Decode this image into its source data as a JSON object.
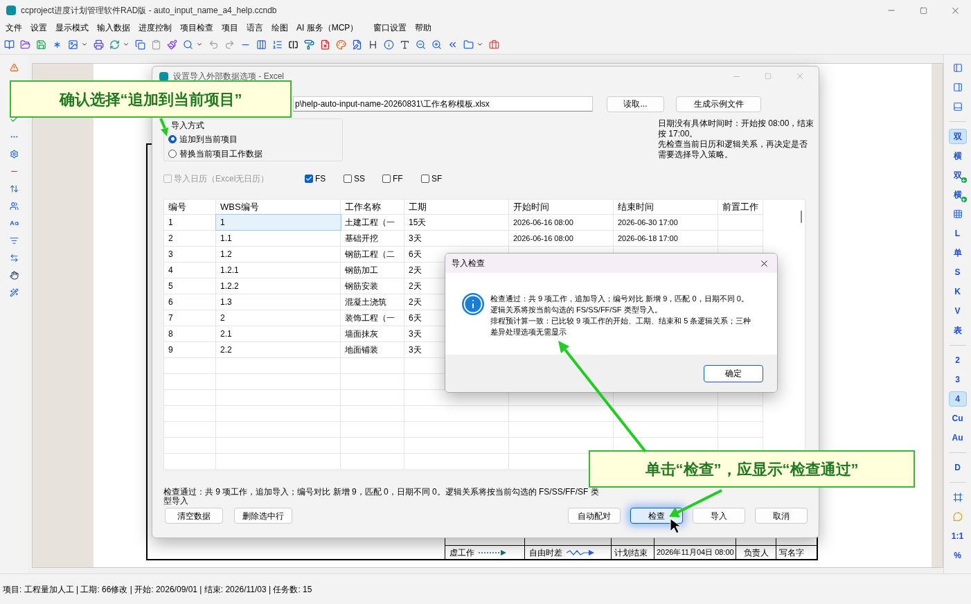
{
  "window": {
    "title": "ccproject进度计划管理软件RAD版 - auto_input_name_a4_help.ccndb"
  },
  "menu": [
    "文件",
    "设置",
    "显示模式",
    "输入数据",
    "进度控制",
    "项目检查",
    "项目",
    "语言",
    "绘图",
    "AI 服务（MCP）",
    "窗口设置",
    "帮助"
  ],
  "right_toolbar": [
    {
      "kind": "panelleft",
      "selected": false
    },
    {
      "kind": "panelright",
      "selected": false
    },
    {
      "kind": "panelbottom",
      "selected": false
    },
    {
      "kind": "separator"
    },
    {
      "kind": "text",
      "label": "双",
      "selected": true
    },
    {
      "kind": "text",
      "label": "横",
      "selected": false
    },
    {
      "kind": "textplus",
      "label": "双",
      "selected": false
    },
    {
      "kind": "textplus",
      "label": "横",
      "selected": false
    },
    {
      "kind": "grid",
      "selected": false
    },
    {
      "kind": "text",
      "label": "L",
      "selected": false
    },
    {
      "kind": "text",
      "label": "单",
      "selected": false
    },
    {
      "kind": "text",
      "label": "S",
      "selected": false
    },
    {
      "kind": "text",
      "label": "K",
      "selected": false
    },
    {
      "kind": "text",
      "label": "V",
      "selected": false
    },
    {
      "kind": "text",
      "label": "表",
      "selected": false
    },
    {
      "kind": "separator"
    },
    {
      "kind": "text",
      "label": "2",
      "selected": false
    },
    {
      "kind": "text",
      "label": "3",
      "selected": false
    },
    {
      "kind": "text",
      "label": "4",
      "selected": true
    },
    {
      "kind": "text",
      "label": "Cu",
      "selected": false
    },
    {
      "kind": "text",
      "label": "Au",
      "selected": false
    },
    {
      "kind": "separator"
    },
    {
      "kind": "text",
      "label": "D",
      "selected": false
    },
    {
      "kind": "separator"
    },
    {
      "kind": "frame",
      "selected": false
    },
    {
      "kind": "bubble",
      "selected": false
    },
    {
      "kind": "text",
      "label": "1:1",
      "selected": false
    },
    {
      "kind": "text",
      "label": "%",
      "selected": false
    }
  ],
  "legend": {
    "rows": [
      {
        "lines": [
          {
            "kind": "dummy",
            "label": "虚工作"
          },
          {
            "kind": "float",
            "label": "自由时差"
          }
        ],
        "field": "计划结束",
        "value": "2026年11月04日 08:00",
        "field2": "负责人",
        "value2": "写名字"
      }
    ]
  },
  "import_dialog": {
    "title": "设置导入外部数据选项 - Excel",
    "file_path": "p\\help-auto-input-name-20260831\\工作名称模板.xlsx",
    "top_buttons": [
      "读取...",
      "生成示例文件"
    ],
    "mode_group": {
      "label": "导入方式",
      "options": [
        {
          "label": "追加到当前项目",
          "selected": true
        },
        {
          "label": "替换当前项目工作数据",
          "selected": false
        }
      ]
    },
    "note": [
      "日期没有具体时间时：开始按 08:00，结束按 17:00。",
      "先检查当前日历和逻辑关系，再决定是否需要选择导入策略。"
    ],
    "options": [
      {
        "label": "导入日历（Excel无日历）",
        "checked": false,
        "disabled": true
      },
      {
        "label": "FS",
        "checked": true,
        "disabled": false
      },
      {
        "label": "SS",
        "checked": false,
        "disabled": false
      },
      {
        "label": "FF",
        "checked": false,
        "disabled": false
      },
      {
        "label": "SF",
        "checked": false,
        "disabled": false
      }
    ],
    "table": {
      "columns": [
        "编号",
        "WBS编号",
        "工作名称",
        "工期",
        "开始时间",
        "结束时间",
        "前置工作"
      ],
      "rows": [
        {
          "cells": [
            "1",
            "1",
            "土建工程（一",
            "15天",
            "2026-06-16 08:00",
            "2026-06-30 17:00"
          ],
          "selected": true
        },
        {
          "cells": [
            "2",
            "1.1",
            "基础开挖",
            "3天",
            "2026-06-16 08:00",
            "2026-06-18 17:00"
          ],
          "selected": false
        },
        {
          "cells": [
            "3",
            "1.2",
            "钢筋工程（二",
            "6天"
          ],
          "selected": false
        },
        {
          "cells": [
            "4",
            "1.2.1",
            "钢筋加工",
            "2天"
          ],
          "selected": false
        },
        {
          "cells": [
            "5",
            "1.2.2",
            "钢筋安装",
            "2天"
          ],
          "selected": false
        },
        {
          "cells": [
            "6",
            "1.3",
            "混凝土浇筑",
            "2天"
          ],
          "selected": false
        },
        {
          "cells": [
            "7",
            "2",
            "装饰工程（一",
            "6天"
          ],
          "selected": false
        },
        {
          "cells": [
            "8",
            "2.1",
            "墙面抹灰",
            "3天"
          ],
          "selected": false
        },
        {
          "cells": [
            "9",
            "2.2",
            "地面铺装",
            "3天"
          ],
          "selected": false
        }
      ]
    },
    "status": "检查通过：共 9 项工作，追加导入；编号对比 新增 9，匹配 0，日期不同 0。逻辑关系将按当前勾选的 FS/SS/FF/SF 类型导入",
    "left_buttons": [
      "清空数据",
      "删除选中行"
    ],
    "right_buttons": [
      {
        "label": "自动配对",
        "hovered": false
      },
      {
        "label": "检查",
        "hovered": true
      },
      {
        "label": "导入",
        "hovered": false
      },
      {
        "label": "取消",
        "hovered": false
      }
    ]
  },
  "message_box": {
    "title": "导入检查",
    "paragraphs": [
      "检查通过：共 9 项工作，追加导入；编号对比 新增 9，匹配 0，日期不同 0。逻辑关系将按当前勾选的 FS/SS/FF/SF 类型导入。",
      "排程预计算一致：已比较 9 项工作的开始、工期、结束和 5 条逻辑关系；三种差异处理选项无需显示"
    ],
    "button": "确定"
  },
  "callouts": [
    "确认选择“追加到当前项目”",
    "单击“检查”，应显示“检查通过”"
  ],
  "status_bar": "项目: 工程量加人工 | 工期: 66修改 | 开始: 2026/09/01 | 结束: 2026/11/03 | 任务数: 15"
}
